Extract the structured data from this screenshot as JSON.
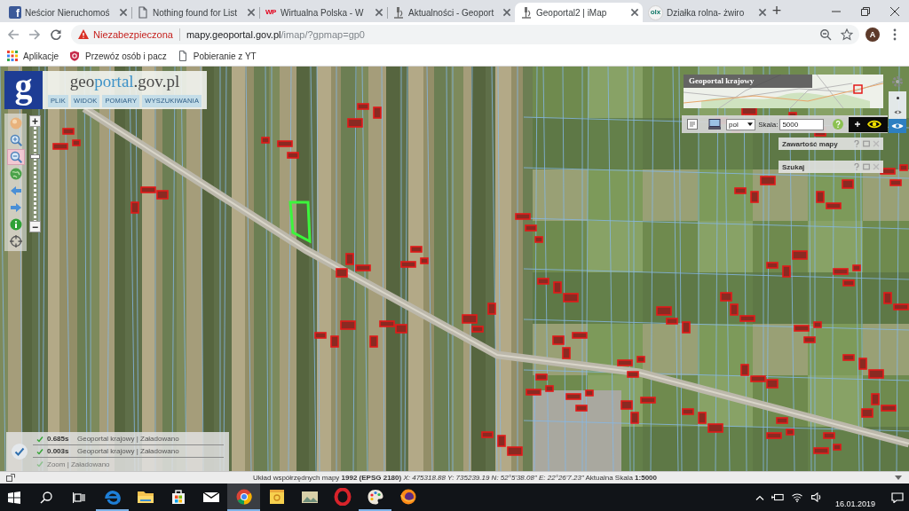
{
  "browser": {
    "tabs": [
      {
        "kind": "tile",
        "favicon": "f",
        "title": "Neścior Nieruchomoś",
        "selected": false
      },
      {
        "kind": "page",
        "title": "Nothing found for List",
        "selected": false
      },
      {
        "kind": "mark",
        "favicon": "WP",
        "title": "Wirtualna Polska - W",
        "selected": false
      },
      {
        "kind": "scope",
        "title": "Aktualności - Geoport",
        "selected": false
      },
      {
        "kind": "scope",
        "title": "Geoportal2 | iMap",
        "selected": true
      },
      {
        "kind": "disc",
        "favicon": "olx",
        "title": "Działka rolna- żwiro",
        "selected": false
      }
    ],
    "new_tab": "+",
    "address": {
      "security": "Niezabezpieczona",
      "host": "mapy.geoportal.gov.pl",
      "path": "/imap/?gpmap=gp0"
    },
    "profile": "A",
    "bookmarks": [
      {
        "kind": "apps",
        "label": "Aplikacje"
      },
      {
        "kind": "shield",
        "label": "Przewóz osób i pacz"
      },
      {
        "kind": "page",
        "label": "Pobieranie z YT"
      }
    ]
  },
  "geoportal": {
    "logo": "g",
    "brand": [
      {
        "text": "geo",
        "accent": false
      },
      {
        "text": "portal",
        "accent": true
      },
      {
        "text": ".gov.pl",
        "accent": false
      }
    ],
    "menu": [
      "PLIK",
      "WIDOK",
      "POMIARY",
      "WYSZUKIWANIA"
    ],
    "tools": [
      {
        "kind": "sphere",
        "selected": false
      },
      {
        "kind": "zoom-in",
        "selected": false
      },
      {
        "kind": "zoom-out",
        "selected": true
      },
      {
        "kind": "globe",
        "selected": false
      },
      {
        "kind": "back",
        "selected": false
      },
      {
        "kind": "forward",
        "selected": false
      },
      {
        "kind": "info",
        "selected": false
      },
      {
        "kind": "crosshair",
        "selected": false
      }
    ],
    "zoom": {
      "plus": "+",
      "minus": "−",
      "level": 0.69
    },
    "overview": {
      "title": "Geoportal krajowy"
    },
    "toolbar": {
      "language": "pol",
      "scale_label": "Skala:",
      "scale": "5000"
    },
    "view_modes": [
      {
        "kind": "dot",
        "selected": false
      },
      {
        "kind": "eye",
        "selected": false
      },
      {
        "kind": "eye",
        "selected": true
      }
    ],
    "panels": [
      {
        "title": "Zawartość mapy"
      },
      {
        "title": "Szukaj"
      }
    ],
    "log": [
      {
        "time": "0.685s",
        "message": "Geoportal krajowy | Załadowano",
        "dimmed": false
      },
      {
        "time": "0.003s",
        "message": "Geoportal krajowy | Załadowano",
        "dimmed": false
      },
      {
        "message": "Zoom | Załadowano",
        "dimmed": true
      }
    ],
    "status": "Układ współrzędnych mapy **1992 (EPSG 2180)** *X: 475318.88 Y: 735239.19 N: 52°5'38.08\" E: 22°26'7.23\"* Aktualna Skala **1:5000**"
  },
  "taskbar": {
    "apps": [
      {
        "kind": "edge",
        "selected": false,
        "running": true
      },
      {
        "kind": "folder",
        "selected": false,
        "running": false
      },
      {
        "kind": "store",
        "selected": false,
        "running": false
      },
      {
        "kind": "mail",
        "selected": false,
        "running": false
      },
      {
        "kind": "chrome",
        "selected": true,
        "running": true
      },
      {
        "kind": "notes",
        "selected": false,
        "running": false
      },
      {
        "kind": "photos",
        "selected": false,
        "running": false
      },
      {
        "kind": "opera",
        "selected": false,
        "running": false
      },
      {
        "kind": "paint",
        "selected": false,
        "running": true
      },
      {
        "kind": "firefox",
        "selected": false,
        "running": false
      }
    ],
    "date": "16.01.2019"
  }
}
